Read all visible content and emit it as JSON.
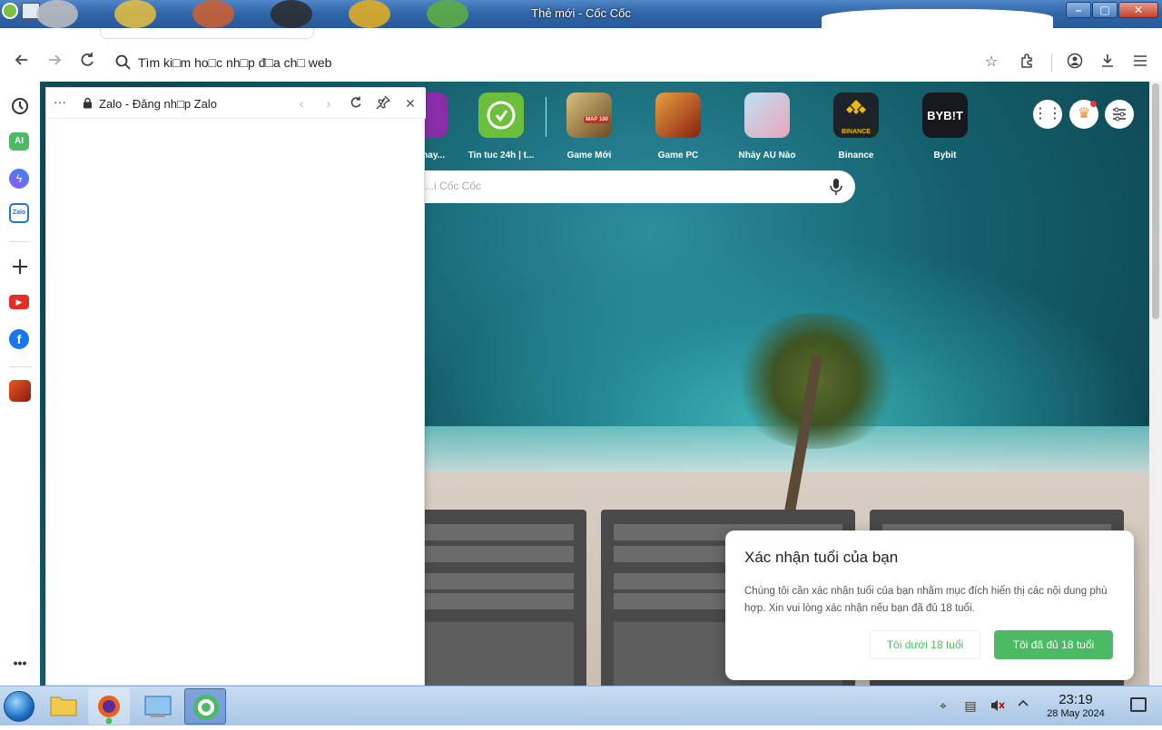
{
  "window": {
    "title": "Thẻ mới - Cốc Cốc",
    "controls": [
      "minimize",
      "maximize",
      "close"
    ]
  },
  "toolbar": {
    "address_placeholder": "Tìm ki□m ho□c nh□p đ□a ch□ web",
    "back_icon": "arrow-left-icon",
    "forward_icon": "arrow-right-icon",
    "reload_icon": "reload-icon"
  },
  "sidebar": {
    "items": [
      {
        "name": "history",
        "icon": "history-icon"
      },
      {
        "name": "ai-chat",
        "icon": "ai-icon",
        "label": "AI"
      },
      {
        "name": "messenger",
        "icon": "messenger-icon"
      },
      {
        "name": "zalo",
        "icon": "zalo-icon",
        "label": "Zalo"
      },
      {
        "name": "add",
        "icon": "plus-icon"
      },
      {
        "name": "youtube",
        "icon": "youtube-icon"
      },
      {
        "name": "facebook",
        "icon": "facebook-icon"
      },
      {
        "name": "game",
        "icon": "game-icon"
      }
    ],
    "more_label": "•••"
  },
  "panel": {
    "title": "Zalo - Đăng nh□p Zalo",
    "more_label": "···"
  },
  "shortcuts": [
    {
      "label": "...hay...",
      "color": "#8a2ea8"
    },
    {
      "label": "Tin tuc 24h | t...",
      "color": "#6bbf3a"
    },
    {
      "label": "Game Mới",
      "color": "#b28a3c",
      "badge": "MAP 100"
    },
    {
      "label": "Game PC",
      "color": "#c8452a"
    },
    {
      "label": "Nhảy AU Nào",
      "color": "#7fb8e0"
    },
    {
      "label": "Binance",
      "color": "#1e2329",
      "badge": "BINANCE"
    },
    {
      "label": "Bybit",
      "color": "#17181e",
      "badge": "BYB!T"
    }
  ],
  "search": {
    "placeholder": "...i Cốc Cốc"
  },
  "dialog": {
    "title": "Xác nhận tuổi của bạn",
    "body": "Chúng tôi cần xác nhận tuổi của bạn nhằm mục đích hiển thị các nội dung phù hợp. Xin vui lòng xác nhận nếu bạn đã đủ 18 tuổi.",
    "under_label": "Tôi dưới 18 tuổi",
    "over_label": "Tôi đã đủ 18 tuổi",
    "accent": "#4cba64"
  },
  "taskbar": {
    "time": "23:19",
    "date": "28 May 2024",
    "apps": [
      "start-orb",
      "file-explorer",
      "firefox",
      "control-panel",
      "coc-coc"
    ]
  }
}
